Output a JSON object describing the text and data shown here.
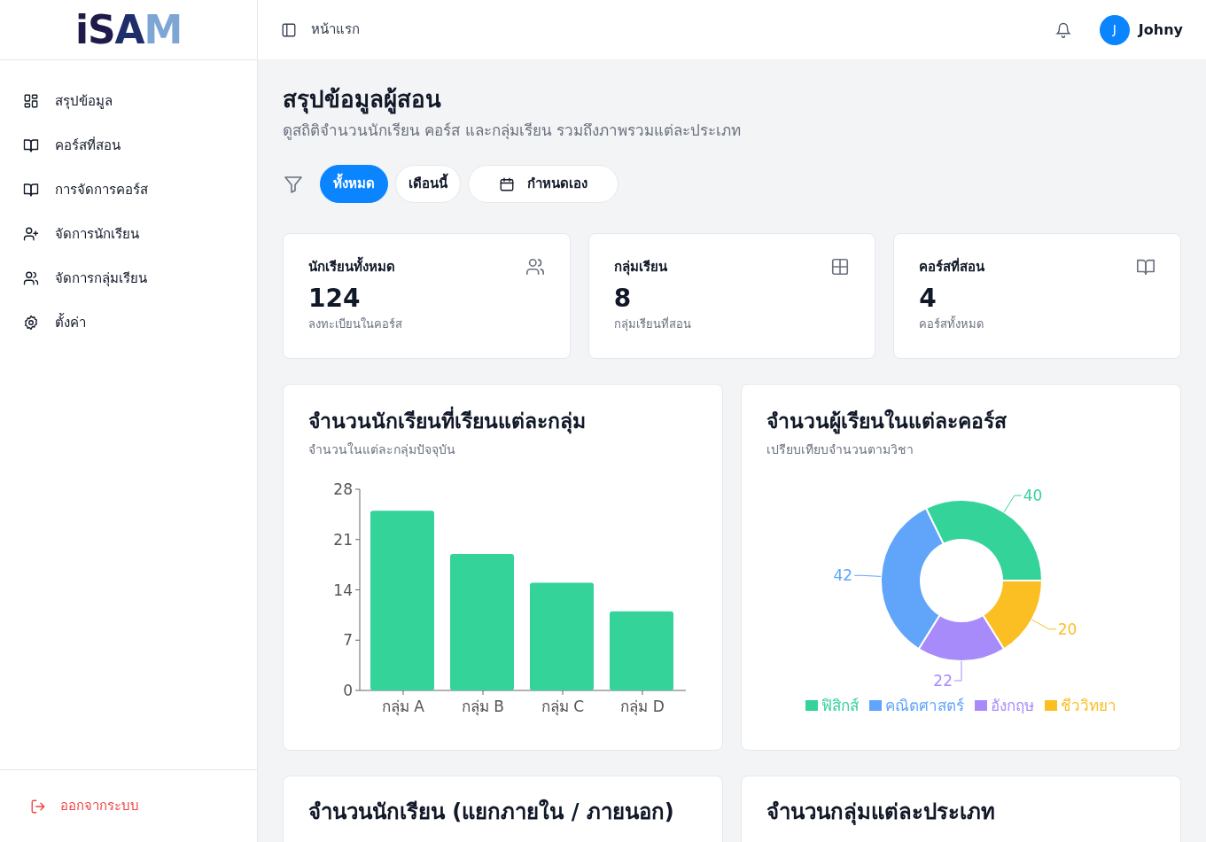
{
  "logo": "iSAM",
  "sidebar": {
    "items": [
      {
        "label": "สรุปข้อมูล"
      },
      {
        "label": "คอร์สที่สอน"
      },
      {
        "label": "การจัดการคอร์ส"
      },
      {
        "label": "จัดการนักเรียน"
      },
      {
        "label": "จัดการกลุ่มเรียน"
      },
      {
        "label": "ตั้งค่า"
      }
    ],
    "logout": "ออกจากระบบ"
  },
  "header": {
    "breadcrumb": "หน้าแรก",
    "user": {
      "initial": "J",
      "name": "Johny"
    }
  },
  "page": {
    "title": "สรุปข้อมูลผู้สอน",
    "subtitle": "ดูสถิติจำนวนนักเรียน คอร์ส และกลุ่มเรียน รวมถึงภาพรวมแต่ละประเภท"
  },
  "filters": [
    {
      "label": "ทั้งหมด",
      "selected": true,
      "kind": "plain"
    },
    {
      "label": "เดือนนี้",
      "selected": false,
      "kind": "plain"
    },
    {
      "label": "กำหนดเอง",
      "selected": false,
      "kind": "date"
    }
  ],
  "stats": [
    {
      "title": "นักเรียนทั้งหมด",
      "value": "124",
      "caption": "ลงทะเบียนในคอร์ส"
    },
    {
      "title": "กลุ่มเรียน",
      "value": "8",
      "caption": "กลุ่มเรียนที่สอน"
    },
    {
      "title": "คอร์สที่สอน",
      "value": "4",
      "caption": "คอร์สทั้งหมด"
    }
  ],
  "charts": [
    {
      "title": "จำนวนนักเรียนที่เรียนแต่ละกลุ่ม",
      "subtitle": "จำนวนในแต่ละกลุ่มปัจจุบัน",
      "chart_data": {
        "type": "bar",
        "categories": [
          "กลุ่ม A",
          "กลุ่ม B",
          "กลุ่ม C",
          "กลุ่ม D"
        ],
        "series": [
          {
            "color": "#34d399",
            "values": [
              25,
              19,
              15,
              11
            ]
          }
        ],
        "ylim": [
          0,
          28
        ],
        "yticks": [
          0,
          7,
          14,
          21,
          28
        ]
      }
    },
    {
      "title": "จำนวนผู้เรียนในแต่ละคอร์ส",
      "subtitle": "เปรียบเทียบจำนวนตามวิชา",
      "chart_data": {
        "type": "donut",
        "categories": [
          "ฟิสิกส์",
          "คณิตศาสตร์",
          "อังกฤษ",
          "ชีววิทยา"
        ],
        "values": [
          40,
          42,
          22,
          20
        ],
        "colors": [
          "#34d399",
          "#60a5fa",
          "#a78bfa",
          "#fbbf24"
        ],
        "data_labels": true,
        "legend": "bottom"
      }
    }
  ],
  "lower_cards": [
    {
      "title": "จำนวนนักเรียน (แยกภายใน / ภายนอก)"
    },
    {
      "title": "จำนวนกลุ่มแต่ละประเภท"
    }
  ]
}
